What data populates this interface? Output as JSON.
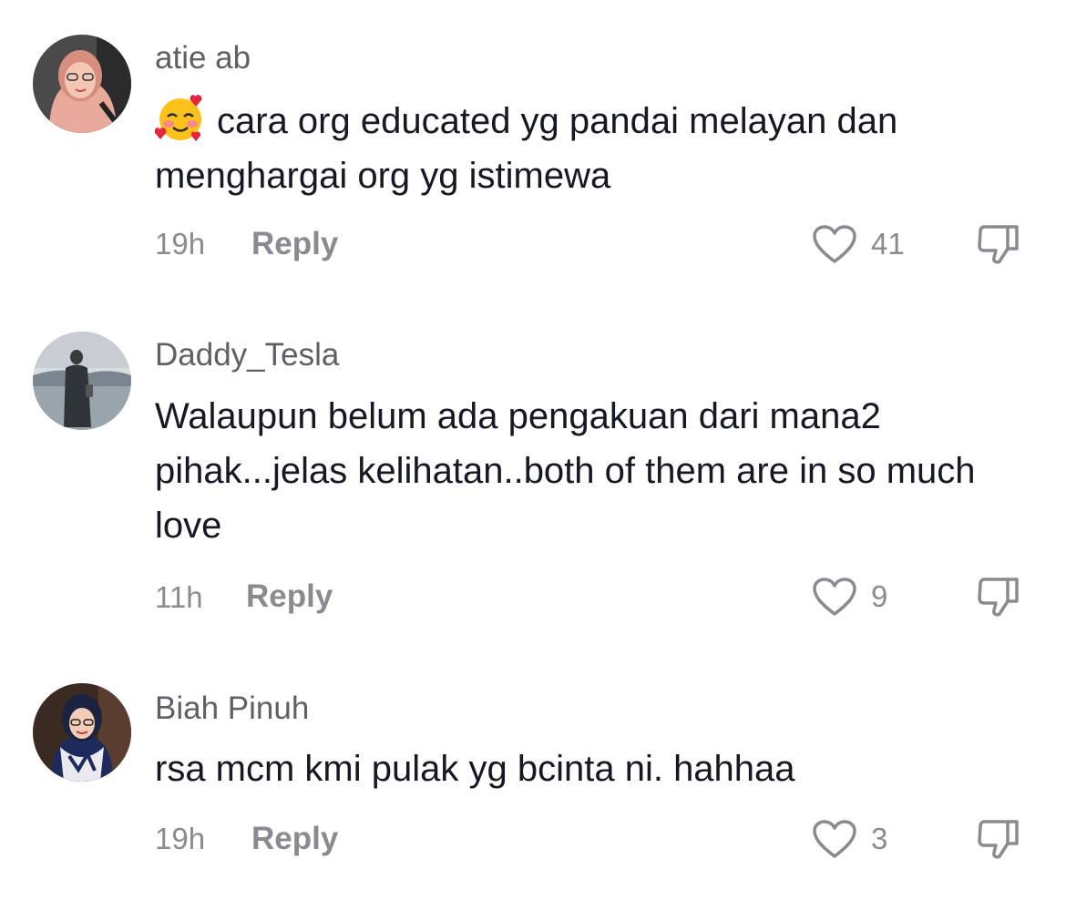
{
  "comments": [
    {
      "username": "atie ab",
      "emoji": "smiling-face-with-hearts-icon",
      "text": "cara org educated yg pandai melayan dan menghargai org yg istimewa",
      "time": "19h",
      "reply_label": "Reply",
      "likes": "41"
    },
    {
      "username": "Daddy_Tesla",
      "text": "Walaupun belum ada pengakuan dari mana2 pihak...jelas kelihatan..both of them are in so much love",
      "time": "11h",
      "reply_label": "Reply",
      "likes": "9"
    },
    {
      "username": "Biah Pinuh",
      "text": "rsa mcm kmi pulak yg bcinta ni. hahhaa",
      "time": "19h",
      "reply_label": "Reply",
      "likes": "3"
    }
  ],
  "icons": {
    "like": "heart-outline-icon",
    "dislike": "thumbs-down-icon"
  },
  "colors": {
    "text": "#161823",
    "username": "#5f5f66",
    "muted": "#8a8b91",
    "background": "#ffffff"
  }
}
